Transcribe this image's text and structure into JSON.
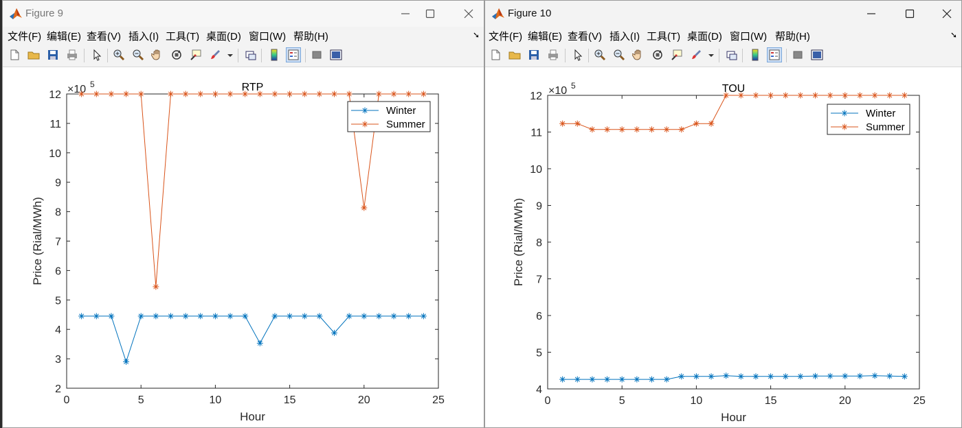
{
  "windows": [
    {
      "title": "Figure 9",
      "menus": [
        "文件(F)",
        "编辑(E)",
        "查看(V)",
        "插入(I)",
        "工具(T)",
        "桌面(D)",
        "窗口(W)",
        "帮助(H)"
      ],
      "chart_data": {
        "type": "line",
        "title": "RTP",
        "xlabel": "Hour",
        "ylabel": "Price (Rial/MWh)",
        "y_exponent_label": "×10",
        "y_exponent": "5",
        "xlim": [
          0,
          25
        ],
        "ylim": [
          2,
          12
        ],
        "xticks": [
          0,
          5,
          10,
          15,
          20,
          25
        ],
        "yticks": [
          2,
          3,
          4,
          5,
          6,
          7,
          8,
          9,
          10,
          11,
          12
        ],
        "grid": false,
        "legend_position": "top-right",
        "x": [
          1,
          2,
          3,
          4,
          5,
          6,
          7,
          8,
          9,
          10,
          11,
          12,
          13,
          14,
          15,
          16,
          17,
          18,
          19,
          20,
          21,
          22,
          23,
          24
        ],
        "series": [
          {
            "name": "Winter",
            "color": "#0072bd",
            "values": [
              4.45,
              4.45,
              4.45,
              2.9,
              4.45,
              4.45,
              4.45,
              4.45,
              4.45,
              4.45,
              4.45,
              4.45,
              3.53,
              4.45,
              4.45,
              4.45,
              4.45,
              3.88,
              4.45,
              4.45,
              4.45,
              4.45,
              4.45,
              4.45
            ]
          },
          {
            "name": "Summer",
            "color": "#d95319",
            "values": [
              12,
              12,
              12,
              12,
              12,
              5.45,
              12,
              12,
              12,
              12,
              12,
              12,
              12,
              12,
              12,
              12,
              12,
              12,
              12,
              8.13,
              12,
              12,
              12,
              12
            ]
          }
        ]
      }
    },
    {
      "title": "Figure 10",
      "menus": [
        "文件(F)",
        "编辑(E)",
        "查看(V)",
        "插入(I)",
        "工具(T)",
        "桌面(D)",
        "窗口(W)",
        "帮助(H)"
      ],
      "chart_data": {
        "type": "line",
        "title": "TOU",
        "xlabel": "Hour",
        "ylabel": "Price (Rial/MWh)",
        "y_exponent_label": "×10",
        "y_exponent": "5",
        "xlim": [
          0,
          25
        ],
        "ylim": [
          4,
          12
        ],
        "xticks": [
          0,
          5,
          10,
          15,
          20,
          25
        ],
        "yticks": [
          4,
          5,
          6,
          7,
          8,
          9,
          10,
          11,
          12
        ],
        "grid": false,
        "legend_position": "top-right",
        "x": [
          1,
          2,
          3,
          4,
          5,
          6,
          7,
          8,
          9,
          10,
          11,
          12,
          13,
          14,
          15,
          16,
          17,
          18,
          19,
          20,
          21,
          22,
          23,
          24
        ],
        "series": [
          {
            "name": "Winter",
            "color": "#0072bd",
            "values": [
              4.26,
              4.26,
              4.26,
              4.26,
              4.26,
              4.26,
              4.26,
              4.26,
              4.34,
              4.34,
              4.34,
              4.36,
              4.34,
              4.34,
              4.34,
              4.34,
              4.34,
              4.35,
              4.35,
              4.35,
              4.35,
              4.36,
              4.35,
              4.34
            ]
          },
          {
            "name": "Summer",
            "color": "#d95319",
            "values": [
              11.23,
              11.23,
              11.07,
              11.07,
              11.07,
              11.07,
              11.07,
              11.07,
              11.07,
              11.23,
              11.23,
              12,
              12,
              12,
              12,
              12,
              12,
              12,
              12,
              12,
              12,
              12,
              12,
              12
            ]
          }
        ]
      }
    }
  ]
}
